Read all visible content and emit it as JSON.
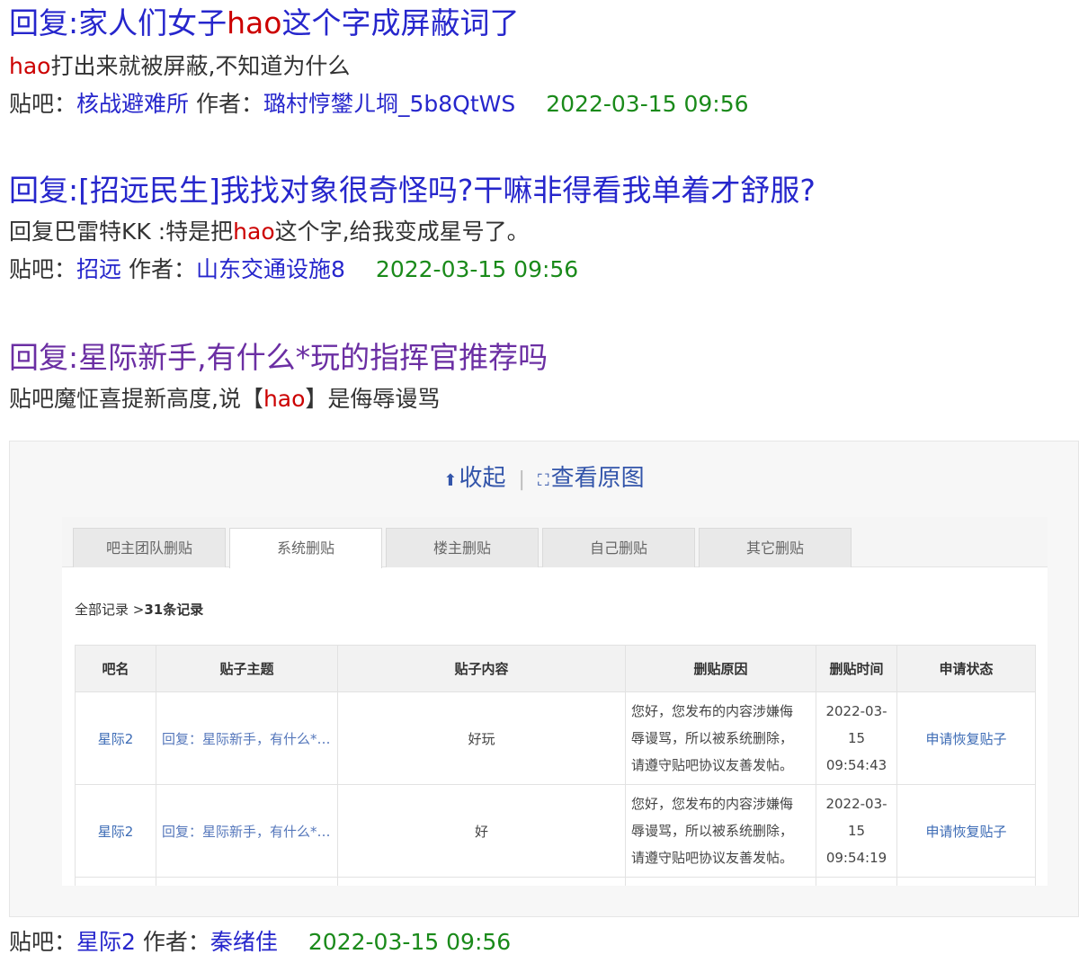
{
  "results": [
    {
      "title_pre": "回复:家人们女子",
      "title_kw": "hao",
      "title_post": "这个字成屏蔽词了",
      "abs_kw": "hao",
      "abs_post": "打出来就被屏蔽,不知道为什么",
      "forum_label": "贴吧：",
      "forum": "核战避难所",
      "author_label": "作者：",
      "author": "璐村悙鐢ㄦ埛_5b8QtWS",
      "date": "2022-03-15 09:56"
    },
    {
      "title": "回复:[招远民生]我找对象很奇怪吗?干嘛非得看我单着才舒服?",
      "abs_pre": "回复巴雷特KK :特是把",
      "abs_kw": "hao",
      "abs_post": "这个字,给我变成星号了。",
      "forum_label": "贴吧：",
      "forum": "招远",
      "author_label": "作者：",
      "author": "山东交通设施8",
      "date": "2022-03-15 09:56"
    },
    {
      "title": "回复:星际新手,有什么*玩的指挥官推荐吗",
      "abs_pre": "贴吧魔怔喜提新高度,说【",
      "abs_kw": "hao",
      "abs_post": "】是侮辱谩骂",
      "forum_label": "贴吧：",
      "forum": "星际2",
      "author_label": "作者：",
      "author": "秦绪佳",
      "date": "2022-03-15 09:56"
    }
  ],
  "image_tools": {
    "collapse": "收起",
    "separator": "|",
    "view_original": "查看原图"
  },
  "screenshot": {
    "tabs": [
      "吧主团队删贴",
      "系统删贴",
      "楼主删贴",
      "自己删贴",
      "其它删贴"
    ],
    "active_tab": 1,
    "breadcrumb_pre": "全部记录 >",
    "breadcrumb_count": "31条记录",
    "columns": [
      "吧名",
      "贴子主题",
      "贴子内容",
      "删贴原因",
      "删贴时间",
      "申请状态"
    ],
    "rows": [
      {
        "forum": "星际2",
        "topic": "回复：星际新手，有什么*玩的指挥官推荐吗",
        "content": "好玩",
        "reason_1": "您好，您发布的内容涉嫌侮",
        "reason_2": "辱谩骂，所以被系统删除，",
        "reason_3": "请遵守贴吧协议友善发帖。",
        "date": "2022-03-15",
        "time": "09:54:43",
        "action": "申请恢复贴子"
      },
      {
        "forum": "星际2",
        "topic": "回复：星际新手，有什么*玩的指挥官推荐吗",
        "content": "好",
        "reason_1": "您好，您发布的内容涉嫌侮",
        "reason_2": "辱谩骂，所以被系统删除，",
        "reason_3": "请遵守贴吧协议友善发帖。",
        "date": "2022-03-15",
        "time": "09:54:19",
        "action": "申请恢复贴子"
      }
    ]
  },
  "colors": {
    "title_link": "#2626cc",
    "visited_link": "#6b2fa3",
    "keyword": "#cc0000",
    "date": "#1a8a1a"
  },
  "icons": {
    "collapse": "arrow-up-icon",
    "view_original": "expand-icon"
  }
}
